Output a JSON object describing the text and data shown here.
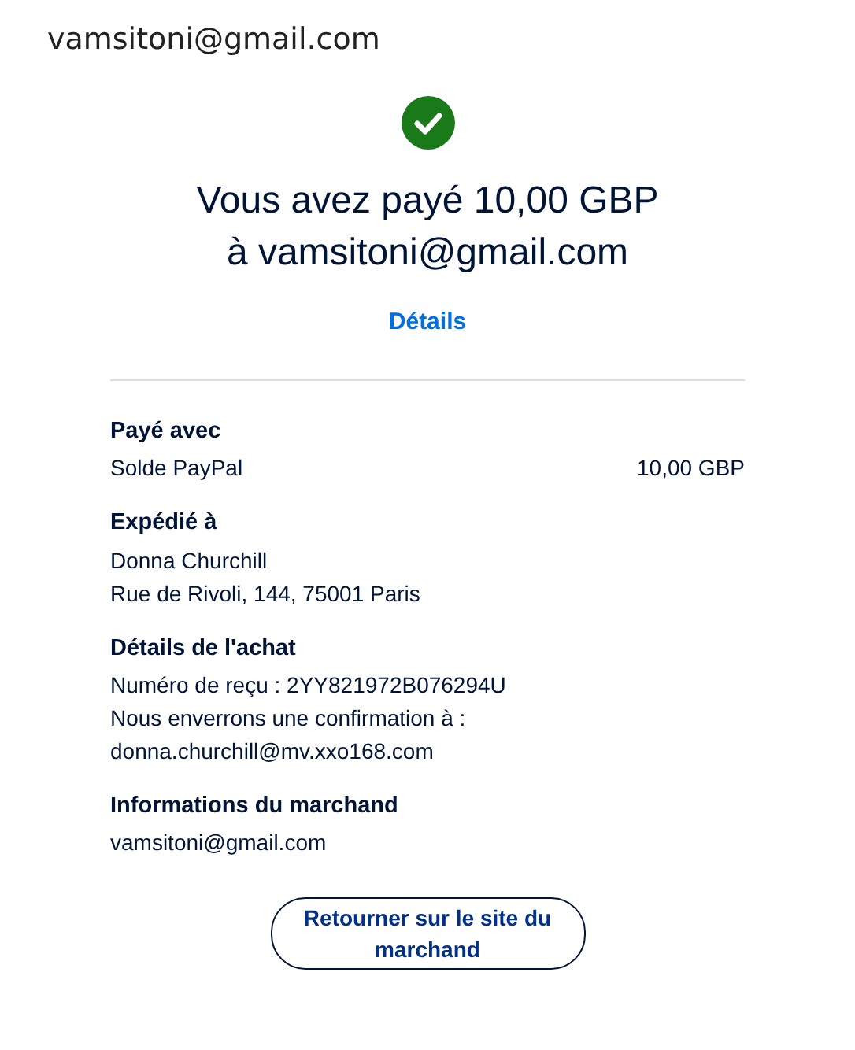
{
  "account_email": "vamsitoni@gmail.com",
  "status": {
    "kind": "success"
  },
  "headline": [
    "Vous avez payé 10,00 GBP",
    "à vamsitoni@gmail.com"
  ],
  "details_link": "Détails",
  "sections": [
    {
      "title": "Payé avec",
      "rows": [
        {
          "text": "Solde PayPal",
          "amount": "10,00 GBP"
        }
      ]
    },
    {
      "title": "Expédié à",
      "rows": [
        {
          "text": "Donna Churchill"
        },
        {
          "text": "Rue de Rivoli, 144, 75001 Paris"
        }
      ]
    },
    {
      "title": "Détails de l'achat",
      "rows": [
        {
          "text": "Numéro de reçu : 2YY821972B076294U"
        },
        {
          "text": "Nous enverrons une confirmation à : donna.churchill@mv.xxo168.com"
        }
      ]
    },
    {
      "title": "Informations du marchand",
      "rows": [
        {
          "text": "vamsitoni@gmail.com"
        }
      ]
    }
  ],
  "return_button": "Retourner sur le site du marchand"
}
